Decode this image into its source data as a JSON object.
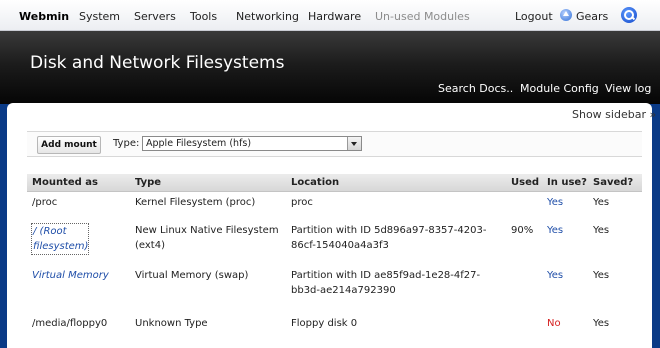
{
  "menu": {
    "brand": "Webmin",
    "items": [
      "System",
      "Servers",
      "Tools",
      "Networking",
      "Hardware"
    ],
    "unused": "Un-used Modules",
    "logout": "Logout",
    "gears": "Gears"
  },
  "header": {
    "title": "Disk and Network Filesystems",
    "links": [
      "Search Docs..",
      "Module Config",
      "View log"
    ]
  },
  "sidebar_toggle": "Show sidebar »",
  "controls": {
    "add_mount": "Add mount",
    "type_label": "Type:",
    "type_value": "Apple Filesystem (hfs)"
  },
  "table": {
    "columns": [
      "Mounted as",
      "Type",
      "Location",
      "Used",
      "In use?",
      "Saved?"
    ],
    "rows": [
      {
        "mounted": "/proc",
        "type": "Kernel Filesystem (proc)",
        "location": "proc",
        "used": "",
        "in_use": "Yes",
        "saved": "Yes"
      },
      {
        "mounted": "/ (Root filesystem)",
        "type": "New Linux Native Filesystem (ext4)",
        "location": "Partition with ID 5d896a97-8357-4203-86cf-154040a4a3f3",
        "used": "90%",
        "in_use": "Yes",
        "saved": "Yes"
      },
      {
        "mounted": "Virtual Memory",
        "type": "Virtual Memory (swap)",
        "location": "Partition with ID ae85f9ad-1e28-4f27-bb3d-ae214a792390",
        "used": "",
        "in_use": "Yes",
        "saved": "Yes"
      },
      {
        "mounted": "/media/floppy0",
        "type": "Unknown Type",
        "location": "Floppy disk 0",
        "used": "",
        "in_use": "No",
        "saved": "Yes"
      }
    ]
  },
  "colors": {
    "link": "#1f4ea8",
    "no": "#d62020",
    "header_bg": "#1c1c1c",
    "page_bg": "#0a3a86"
  }
}
